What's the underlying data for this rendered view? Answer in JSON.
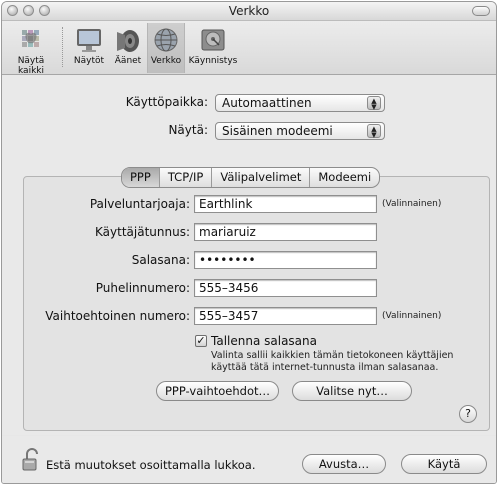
{
  "window": {
    "title": "Verkko"
  },
  "toolbar": {
    "items": [
      {
        "label": "Näytä kaikki",
        "icon": "apple-icon"
      },
      {
        "label": "Näytöt",
        "icon": "display-icon"
      },
      {
        "label": "Äänet",
        "icon": "speaker-icon"
      },
      {
        "label": "Verkko",
        "icon": "network-globe-icon",
        "selected": true
      },
      {
        "label": "Käynnistys",
        "icon": "startup-disk-icon"
      }
    ]
  },
  "location": {
    "label": "Käyttöpaikka:",
    "value": "Automaattinen"
  },
  "show": {
    "label": "Näytä:",
    "value": "Sisäinen modeemi"
  },
  "tabs": [
    {
      "label": "PPP",
      "active": true
    },
    {
      "label": "TCP/IP"
    },
    {
      "label": "Välipalvelimet"
    },
    {
      "label": "Modeemi"
    }
  ],
  "form": {
    "provider": {
      "label": "Palveluntarjoaja:",
      "value": "Earthlink",
      "note": "(Valinnainen)"
    },
    "account": {
      "label": "Käyttäjätunnus:",
      "value": "mariaruiz"
    },
    "password": {
      "label": "Salasana:",
      "value": "••••••••"
    },
    "phone": {
      "label": "Puhelinnumero:",
      "value": "555–3456"
    },
    "alt_phone": {
      "label": "Vaihtoehtoinen numero:",
      "value": "555–3457",
      "note": "(Valinnainen)"
    },
    "save_password": {
      "label": "Tallenna salasana",
      "checked": true,
      "description_line1": "Valinta sallii kaikkien tämän tietokoneen käyttäjien",
      "description_line2": "käyttää tätä internet-tunnusta ilman salasanaa."
    }
  },
  "buttons": {
    "ppp_options": "PPP-vaihtoehdot…",
    "dial_now": "Valitse nyt…",
    "help": "?",
    "assist": "Avusta…",
    "apply": "Käytä"
  },
  "lock": {
    "text": "Estä muutokset osoittamalla lukkoa."
  }
}
